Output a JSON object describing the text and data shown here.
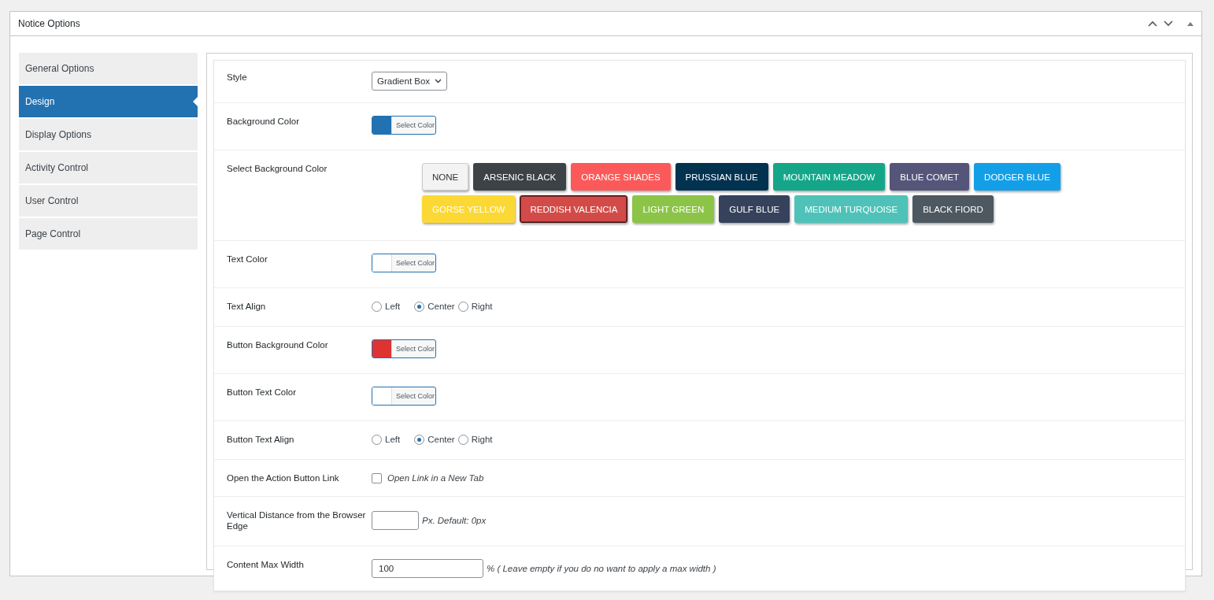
{
  "panel": {
    "title": "Notice Options"
  },
  "sidebar": {
    "items": [
      {
        "label": "General Options",
        "selected": false
      },
      {
        "label": "Design",
        "selected": true
      },
      {
        "label": "Display Options",
        "selected": false
      },
      {
        "label": "Activity Control",
        "selected": false
      },
      {
        "label": "User Control",
        "selected": false
      },
      {
        "label": "Page Control",
        "selected": false
      }
    ]
  },
  "rows": [
    {
      "kind": "select",
      "label": "Style",
      "value": "Gradient Box"
    },
    {
      "kind": "color",
      "label": "Background Color",
      "color": "#2271b1",
      "button": "Select Color"
    },
    {
      "kind": "swatches",
      "label": "Select Background Color",
      "swatches": [
        {
          "label": "NONE",
          "color": "#f3f3f3",
          "selected": false
        },
        {
          "label": "ARSENIC BLACK",
          "color": "#3d4246",
          "selected": false
        },
        {
          "label": "ORANGE SHADES",
          "color": "#fc5a5a",
          "selected": false
        },
        {
          "label": "PRUSSIAN BLUE",
          "color": "#01324f",
          "selected": false
        },
        {
          "label": "MOUNTAIN MEADOW",
          "color": "#15a689",
          "selected": false
        },
        {
          "label": "BLUE COMET",
          "color": "#55557a",
          "selected": false
        },
        {
          "label": "DODGER BLUE",
          "color": "#139fe8",
          "selected": false
        },
        {
          "label": "GORSE YELLOW",
          "color": "#fcd835",
          "selected": false
        },
        {
          "label": "REDDISH VALENCIA",
          "color": "#d24b48",
          "selected": true
        },
        {
          "label": "LIGHT GREEN",
          "color": "#8cc448",
          "selected": false
        },
        {
          "label": "GULF BLUE",
          "color": "#36425c",
          "selected": false
        },
        {
          "label": "MEDIUM TURQUOISE",
          "color": "#4ec2b8",
          "selected": false
        },
        {
          "label": "BLACK FIORD",
          "color": "#4d5860",
          "selected": false
        }
      ]
    },
    {
      "kind": "color",
      "label": "Text Color",
      "color": "#ffffff",
      "button": "Select Color"
    },
    {
      "kind": "radio",
      "label": "Text Align",
      "options": [
        {
          "label": "Left",
          "selected": false
        },
        {
          "label": "Center",
          "selected": true
        },
        {
          "label": "Right",
          "selected": false
        }
      ]
    },
    {
      "kind": "color",
      "label": "Button Background Color",
      "color": "#dd3333",
      "button": "Select Color"
    },
    {
      "kind": "color",
      "label": "Button Text Color",
      "color": "#ffffff",
      "button": "Select Color"
    },
    {
      "kind": "radio",
      "label": "Button Text Align",
      "options": [
        {
          "label": "Left",
          "selected": false
        },
        {
          "label": "Center",
          "selected": true
        },
        {
          "label": "Right",
          "selected": false
        }
      ]
    },
    {
      "kind": "checkbox",
      "label": "Open the Action Button Link",
      "checked": false,
      "text": "Open Link in a New Tab"
    },
    {
      "kind": "short-input",
      "label": "Vertical Distance from the Browser Edge",
      "hint": "Px. Default: 0px"
    },
    {
      "kind": "long-input",
      "label": "Content Max Width",
      "value": "100",
      "hint": "% ( Leave empty if you do no want to apply a max width )"
    }
  ]
}
